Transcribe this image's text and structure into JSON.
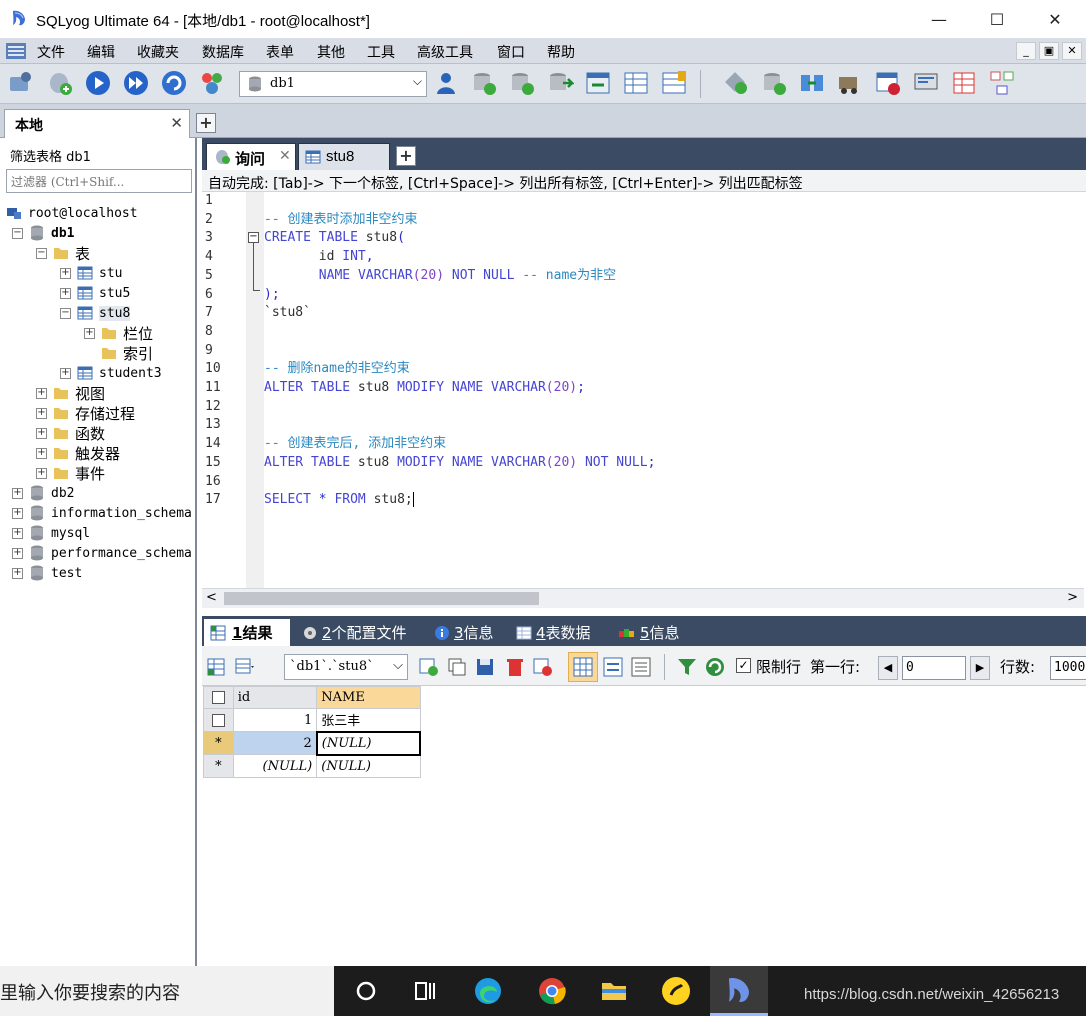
{
  "window": {
    "title": "SQLyog Ultimate 64 - [本地/db1 - root@localhost*]",
    "minimize": "—",
    "maximize": "☐",
    "close": "✕"
  },
  "menu": {
    "items": [
      "文件",
      "编辑",
      "收藏夹",
      "数据库",
      "表单",
      "其他",
      "工具",
      "高级工具",
      "窗口",
      "帮助"
    ],
    "mdi_min": "_",
    "mdi_restore": "▣",
    "mdi_close": "✕"
  },
  "toolbar": {
    "db_selected": "db1"
  },
  "connection": {
    "tab_label": "本地",
    "close": "✕",
    "add": "+"
  },
  "left_panel": {
    "title": "筛选表格 db1",
    "filter_placeholder": "过滤器 (Ctrl+Shif...",
    "tree": {
      "root": "root@localhost",
      "db1": "db1",
      "tables_folder": "表",
      "tables": [
        "stu",
        "stu5",
        "stu8",
        "student3"
      ],
      "stu8_children": [
        "栏位",
        "索引"
      ],
      "other_folders": [
        "视图",
        "存储过程",
        "函数",
        "触发器",
        "事件"
      ],
      "other_dbs": [
        "db2",
        "information_schema",
        "mysql",
        "performance_schema",
        "test"
      ]
    }
  },
  "editor": {
    "tabs": [
      {
        "label": "询问",
        "close": "✕"
      },
      {
        "label": "stu8"
      }
    ],
    "add_tab": "+",
    "autocomplete": "自动完成: [Tab]-> 下一个标签, [Ctrl+Space]-> 列出所有标签, [Ctrl+Enter]-> 列出匹配标签",
    "line_numbers": [
      "1",
      "2",
      "3",
      "4",
      "5",
      "6",
      "7",
      "8",
      "9",
      "10",
      "11",
      "12",
      "13",
      "14",
      "15",
      "16",
      "17"
    ],
    "code": {
      "comment1": "-- 创建表时添加非空约束",
      "kw_create_table": "CREATE TABLE",
      "tbl_stu8": "stu8",
      "paren_open": "(",
      "col_id": "id",
      "type_int": "INT",
      "comma": ",",
      "col_name": "NAME",
      "type_varchar": "VARCHAR",
      "len20": "(20)",
      "not_null": "NOT NULL",
      "comment_inline": "-- name为非空",
      "close_stmt": ");",
      "backtick_stu8": "`stu8`",
      "comment2": "-- 删除name的非空约束",
      "kw_alter_table": "ALTER TABLE",
      "kw_modify": "MODIFY",
      "semicolon": ";",
      "comment3": "-- 创建表完后, 添加非空约束",
      "kw_not_null": "NOT NULL",
      "kw_select": "SELECT",
      "star": "*",
      "kw_from": "FROM",
      "tbl_stu8_semi": "stu8;"
    },
    "scroll_left": "<",
    "scroll_right": ">"
  },
  "results": {
    "tabs": [
      {
        "num": "1",
        "label": " 结果"
      },
      {
        "num": "2",
        "label": " 个配置文件"
      },
      {
        "num": "3",
        "label": " 信息"
      },
      {
        "num": "4",
        "label": " 表数据"
      },
      {
        "num": "5",
        "label": " 信息"
      }
    ],
    "table_select": "`db1`.`stu8`",
    "limit_label": "限制行",
    "limit_checked": "✓",
    "first_row_label": "第一行:",
    "first_row_value": "0",
    "row_count_label": "行数:",
    "row_count_value": "1000",
    "grid": {
      "columns": [
        "id",
        "NAME"
      ],
      "rows": [
        {
          "marker": "",
          "id": "1",
          "name": "张三丰"
        },
        {
          "marker": "*",
          "id": "2",
          "name": "(NULL)"
        },
        {
          "marker": "*",
          "id": "(NULL)",
          "name": "(NULL)"
        }
      ]
    }
  },
  "taskbar": {
    "search_text": "里输入你要搜索的内容",
    "watermark": "https://blog.csdn.net/weixin_42656213"
  },
  "colors": {
    "keyword": "#4545d3",
    "comment": "#2c8ac0",
    "dark_tab_bg": "#3a4b63",
    "selection": "#bed3ee",
    "header_highlight": "#f9d89a"
  }
}
